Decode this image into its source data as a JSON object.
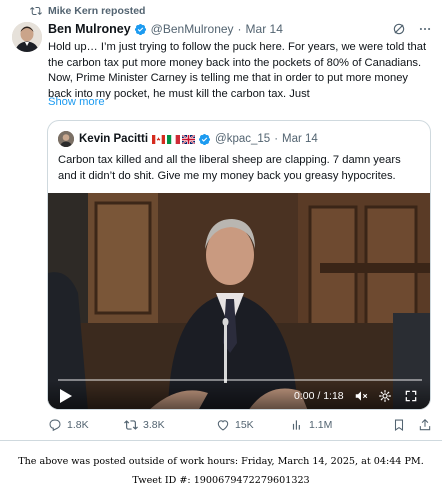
{
  "repost": {
    "label": "Mike Kern reposted"
  },
  "tweet": {
    "author_name": "Ben Mulroney",
    "handle": "@BenMulroney",
    "separator": "·",
    "time": "Mar 14",
    "text": "Hold up… I’m just trying to follow the puck here. For years, we were told that the carbon tax put more money back into the pockets of 80% of Canadians. Now, Prime Minister Carney is telling me that in order to put more money back into my pocket, he must kill the carbon tax. Just",
    "show_more": "Show more"
  },
  "quote": {
    "author_name": "Kevin Pacitti",
    "handle": "@kpac_15",
    "separator": "·",
    "time": "Mar 14",
    "text": "Carbon tax killed and all the liberal sheep are clapping. 7 damn years and it didn’t do shit. Give me my money back you greasy hypocrites.",
    "video": {
      "time": "0:00 / 1:18"
    }
  },
  "actions": {
    "replies": "1.8K",
    "reposts": "3.8K",
    "likes": "15K",
    "views": "1.1M"
  },
  "footer": {
    "line1": "The above was posted outside of work hours: Friday, March 14, 2025, at 04:44 PM.",
    "line2": "Tweet ID #: 1900679472279601323"
  },
  "colors": {
    "accent": "#1d9bf0",
    "muted": "#536471",
    "text": "#0f1419",
    "border": "#cfd9de"
  }
}
